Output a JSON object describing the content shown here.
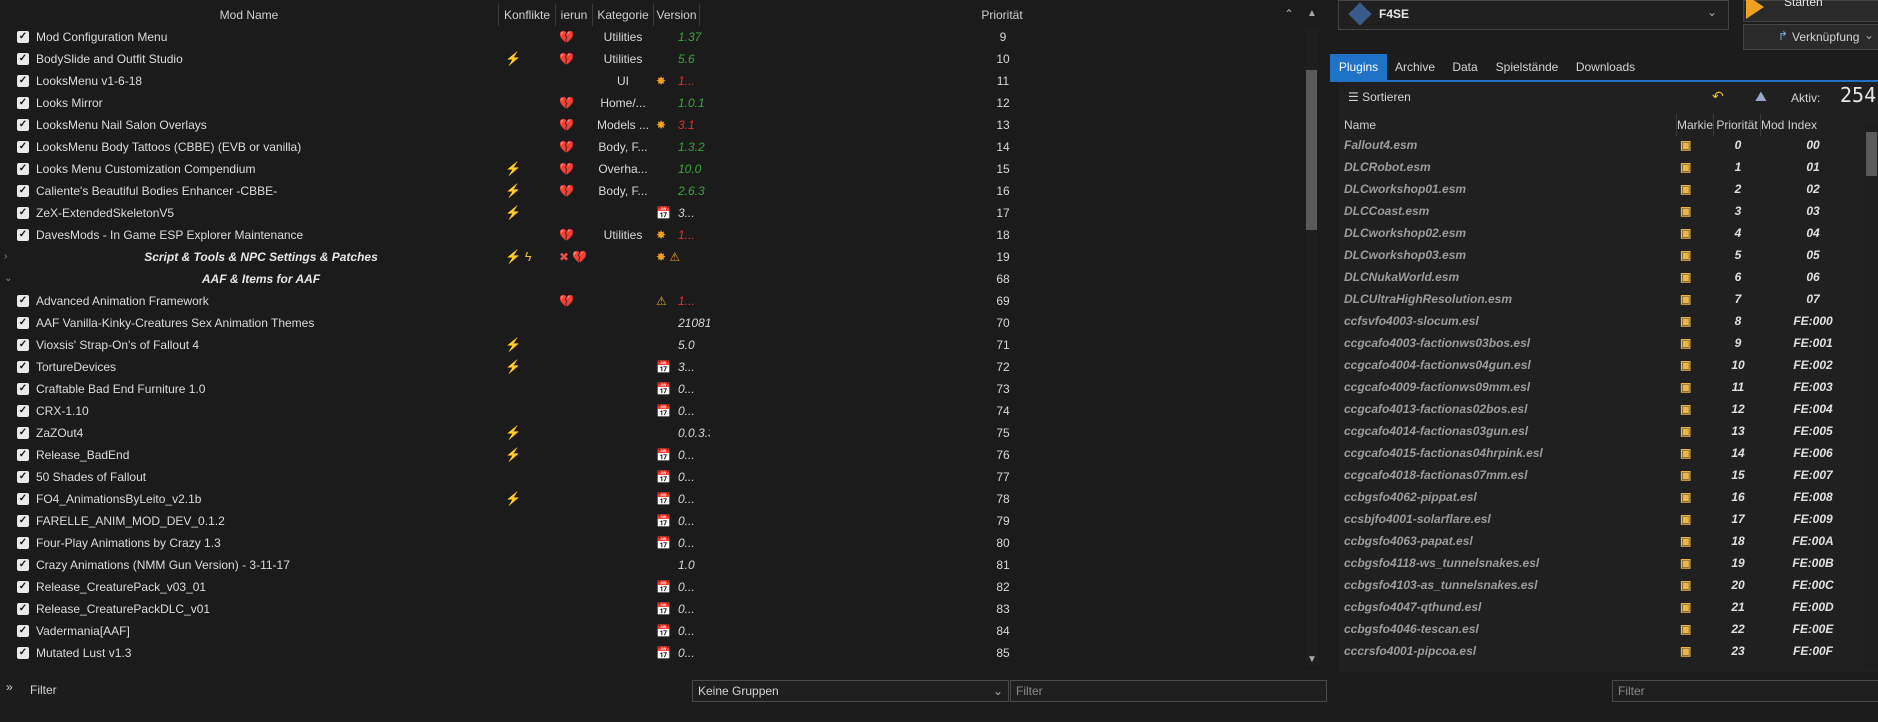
{
  "left": {
    "columns": [
      "Mod Name",
      "Konflikte",
      "ierun",
      "Kategorie",
      "Version",
      "Priorität"
    ],
    "rows": [
      {
        "name": "Mod Configuration Menu",
        "checked": true,
        "conflict": "",
        "flag": "💔",
        "cat": "Utilities",
        "vicon": "",
        "ver": "1.37",
        "vcolor": "#3aa63a",
        "prio": "9"
      },
      {
        "name": "BodySlide and Outfit Studio",
        "checked": true,
        "conflict": "⚡",
        "flag": "💔",
        "cat": "Utilities",
        "vicon": "",
        "ver": "5.6",
        "vcolor": "#3aa63a",
        "prio": "10"
      },
      {
        "name": "LooksMenu v1-6-18",
        "checked": true,
        "conflict": "",
        "flag": "",
        "cat": "UI",
        "vicon": "✸",
        "ver": "1...",
        "vcolor": "#e03030",
        "prio": "11"
      },
      {
        "name": "Looks Mirror",
        "checked": true,
        "conflict": "",
        "flag": "💔",
        "cat": "Home/...",
        "vicon": "",
        "ver": "1.0.1",
        "vcolor": "#3aa63a",
        "prio": "12"
      },
      {
        "name": "LooksMenu Nail Salon Overlays",
        "checked": true,
        "conflict": "",
        "flag": "💔",
        "cat": "Models ...",
        "vicon": "✸",
        "ver": "3.1",
        "vcolor": "#e03030",
        "prio": "13"
      },
      {
        "name": "LooksMenu Body Tattoos (CBBE) (EVB or vanilla)",
        "checked": true,
        "conflict": "",
        "flag": "💔",
        "cat": "Body, F...",
        "vicon": "",
        "ver": "1.3.2",
        "vcolor": "#3aa63a",
        "prio": "14"
      },
      {
        "name": "Looks Menu Customization Compendium",
        "checked": true,
        "conflict": "⚡",
        "flag": "💔",
        "cat": "Overha...",
        "vicon": "",
        "ver": "10.0",
        "vcolor": "#3aa63a",
        "prio": "15"
      },
      {
        "name": "Caliente's Beautiful Bodies Enhancer -CBBE-",
        "checked": true,
        "conflict": "⚡",
        "flag": "💔",
        "cat": "Body, F...",
        "vicon": "",
        "ver": "2.6.3",
        "vcolor": "#3aa63a",
        "prio": "16"
      },
      {
        "name": "ZeX-ExtendedSkeletonV5",
        "checked": true,
        "conflict": "⚡",
        "flag": "",
        "cat": "",
        "vicon": "📅",
        "ver": "3...",
        "vcolor": "#d8d8d8",
        "prio": "17"
      },
      {
        "name": "DavesMods - In Game ESP Explorer Maintenance",
        "checked": true,
        "conflict": "",
        "flag": "💔",
        "cat": "Utilities",
        "vicon": "✸",
        "ver": "1...",
        "vcolor": "#e03030",
        "prio": "18"
      },
      {
        "name": "Script & Tools & NPC Settings & Patches",
        "sep": true,
        "expander": "›",
        "conflict": "⚡ ϟ",
        "flag": "✖ 💔",
        "cat": "",
        "vicon": "✸ ⚠",
        "ver": "",
        "vcolor": "#d8d8d8",
        "prio": "19"
      },
      {
        "name": "AAF & Items for AAF",
        "sep": true,
        "expander": "⌄",
        "conflict": "",
        "flag": "",
        "cat": "",
        "vicon": "",
        "ver": "",
        "vcolor": "#d8d8d8",
        "prio": "68"
      },
      {
        "name": "Advanced Animation Framework",
        "checked": true,
        "conflict": "",
        "flag": "💔",
        "cat": "",
        "vicon": "⚠",
        "ver": "1...",
        "vcolor": "#e03030",
        "prio": "69"
      },
      {
        "name": "AAF Vanilla-Kinky-Creatures Sex Animation Themes",
        "checked": true,
        "conflict": "",
        "flag": "",
        "cat": "",
        "vicon": "",
        "ver": "21081...",
        "vcolor": "#d8d8d8",
        "prio": "70"
      },
      {
        "name": "Vioxsis' Strap-On's of Fallout 4",
        "checked": true,
        "conflict": "⚡",
        "flag": "",
        "cat": "",
        "vicon": "",
        "ver": "5.0",
        "vcolor": "#d8d8d8",
        "prio": "71"
      },
      {
        "name": "TortureDevices",
        "checked": true,
        "conflict": "⚡",
        "flag": "",
        "cat": "",
        "vicon": "📅",
        "ver": "3...",
        "vcolor": "#d8d8d8",
        "prio": "72"
      },
      {
        "name": "Craftable Bad End Furniture 1.0",
        "checked": true,
        "conflict": "",
        "flag": "",
        "cat": "",
        "vicon": "📅",
        "ver": "0...",
        "vcolor": "#d8d8d8",
        "prio": "73"
      },
      {
        "name": "CRX-1.10",
        "checked": true,
        "conflict": "",
        "flag": "",
        "cat": "",
        "vicon": "📅",
        "ver": "0...",
        "vcolor": "#d8d8d8",
        "prio": "74"
      },
      {
        "name": "ZaZOut4",
        "checked": true,
        "conflict": "⚡",
        "flag": "",
        "cat": "",
        "vicon": "",
        "ver": "0.0.3.3...",
        "vcolor": "#d8d8d8",
        "prio": "75"
      },
      {
        "name": "Release_BadEnd",
        "checked": true,
        "conflict": "⚡",
        "flag": "",
        "cat": "",
        "vicon": "📅",
        "ver": "0...",
        "vcolor": "#d8d8d8",
        "prio": "76"
      },
      {
        "name": "50 Shades of Fallout",
        "checked": true,
        "conflict": "",
        "flag": "",
        "cat": "",
        "vicon": "📅",
        "ver": "0...",
        "vcolor": "#d8d8d8",
        "prio": "77"
      },
      {
        "name": "FO4_AnimationsByLeito_v2.1b",
        "checked": true,
        "conflict": "⚡",
        "flag": "",
        "cat": "",
        "vicon": "📅",
        "ver": "0...",
        "vcolor": "#d8d8d8",
        "prio": "78"
      },
      {
        "name": "FARELLE_ANIM_MOD_DEV_0.1.2",
        "checked": true,
        "conflict": "",
        "flag": "",
        "cat": "",
        "vicon": "📅",
        "ver": "0...",
        "vcolor": "#d8d8d8",
        "prio": "79"
      },
      {
        "name": "Four-Play Animations by Crazy 1.3",
        "checked": true,
        "conflict": "",
        "flag": "",
        "cat": "",
        "vicon": "📅",
        "ver": "0...",
        "vcolor": "#d8d8d8",
        "prio": "80"
      },
      {
        "name": "Crazy Animations (NMM Gun Version) - 3-11-17",
        "checked": true,
        "conflict": "",
        "flag": "",
        "cat": "",
        "vicon": "",
        "ver": "1.0",
        "vcolor": "#d8d8d8",
        "prio": "81"
      },
      {
        "name": "Release_CreaturePack_v03_01",
        "checked": true,
        "conflict": "",
        "flag": "",
        "cat": "",
        "vicon": "📅",
        "ver": "0...",
        "vcolor": "#d8d8d8",
        "prio": "82"
      },
      {
        "name": "Release_CreaturePackDLC_v01",
        "checked": true,
        "conflict": "",
        "flag": "",
        "cat": "",
        "vicon": "📅",
        "ver": "0...",
        "vcolor": "#d8d8d8",
        "prio": "83"
      },
      {
        "name": "Vadermania[AAF]",
        "checked": true,
        "conflict": "",
        "flag": "",
        "cat": "",
        "vicon": "📅",
        "ver": "0...",
        "vcolor": "#d8d8d8",
        "prio": "84"
      },
      {
        "name": "Mutated Lust v1.3",
        "checked": true,
        "conflict": "",
        "flag": "",
        "cat": "",
        "vicon": "📅",
        "ver": "0...",
        "vcolor": "#d8d8d8",
        "prio": "85"
      }
    ],
    "filter_label": "Filter",
    "group_select": "Keine Gruppen",
    "filter_placeholder": "Filter"
  },
  "right": {
    "executable": "F4SE",
    "run_label": "Starten",
    "shortcut_label": "Verknüpfung",
    "tabs": [
      "Plugins",
      "Archive",
      "Data",
      "Spielstände",
      "Downloads"
    ],
    "sort_label": "Sortieren",
    "active_label": "Aktiv:",
    "active_count": "254",
    "columns": [
      "Name",
      "Markie",
      "Priorität",
      "Mod Index"
    ],
    "plugins": [
      {
        "name": "Fallout4.esm",
        "prio": "0",
        "idx": "00"
      },
      {
        "name": "DLCRobot.esm",
        "prio": "1",
        "idx": "01"
      },
      {
        "name": "DLCworkshop01.esm",
        "prio": "2",
        "idx": "02"
      },
      {
        "name": "DLCCoast.esm",
        "prio": "3",
        "idx": "03"
      },
      {
        "name": "DLCworkshop02.esm",
        "prio": "4",
        "idx": "04"
      },
      {
        "name": "DLCworkshop03.esm",
        "prio": "5",
        "idx": "05"
      },
      {
        "name": "DLCNukaWorld.esm",
        "prio": "6",
        "idx": "06"
      },
      {
        "name": "DLCUltraHighResolution.esm",
        "prio": "7",
        "idx": "07"
      },
      {
        "name": "ccfsvfo4003-slocum.esl",
        "prio": "8",
        "idx": "FE:000"
      },
      {
        "name": "ccgcafo4003-factionws03bos.esl",
        "prio": "9",
        "idx": "FE:001"
      },
      {
        "name": "ccgcafo4004-factionws04gun.esl",
        "prio": "10",
        "idx": "FE:002"
      },
      {
        "name": "ccgcafo4009-factionws09mm.esl",
        "prio": "11",
        "idx": "FE:003"
      },
      {
        "name": "ccgcafo4013-factionas02bos.esl",
        "prio": "12",
        "idx": "FE:004"
      },
      {
        "name": "ccgcafo4014-factionas03gun.esl",
        "prio": "13",
        "idx": "FE:005"
      },
      {
        "name": "ccgcafo4015-factionas04hrpink.esl",
        "prio": "14",
        "idx": "FE:006"
      },
      {
        "name": "ccgcafo4018-factionas07mm.esl",
        "prio": "15",
        "idx": "FE:007"
      },
      {
        "name": "ccbgsfo4062-pippat.esl",
        "prio": "16",
        "idx": "FE:008"
      },
      {
        "name": "ccsbjfo4001-solarflare.esl",
        "prio": "17",
        "idx": "FE:009"
      },
      {
        "name": "ccbgsfo4063-papat.esl",
        "prio": "18",
        "idx": "FE:00A"
      },
      {
        "name": "ccbgsfo4118-ws_tunnelsnakes.esl",
        "prio": "19",
        "idx": "FE:00B"
      },
      {
        "name": "ccbgsfo4103-as_tunnelsnakes.esl",
        "prio": "20",
        "idx": "FE:00C"
      },
      {
        "name": "ccbgsfo4047-qthund.esl",
        "prio": "21",
        "idx": "FE:00D"
      },
      {
        "name": "ccbgsfo4046-tescan.esl",
        "prio": "22",
        "idx": "FE:00E"
      },
      {
        "name": "cccrsfo4001-pipcoa.esl",
        "prio": "23",
        "idx": "FE:00F"
      }
    ],
    "filter_placeholder": "Filter"
  }
}
